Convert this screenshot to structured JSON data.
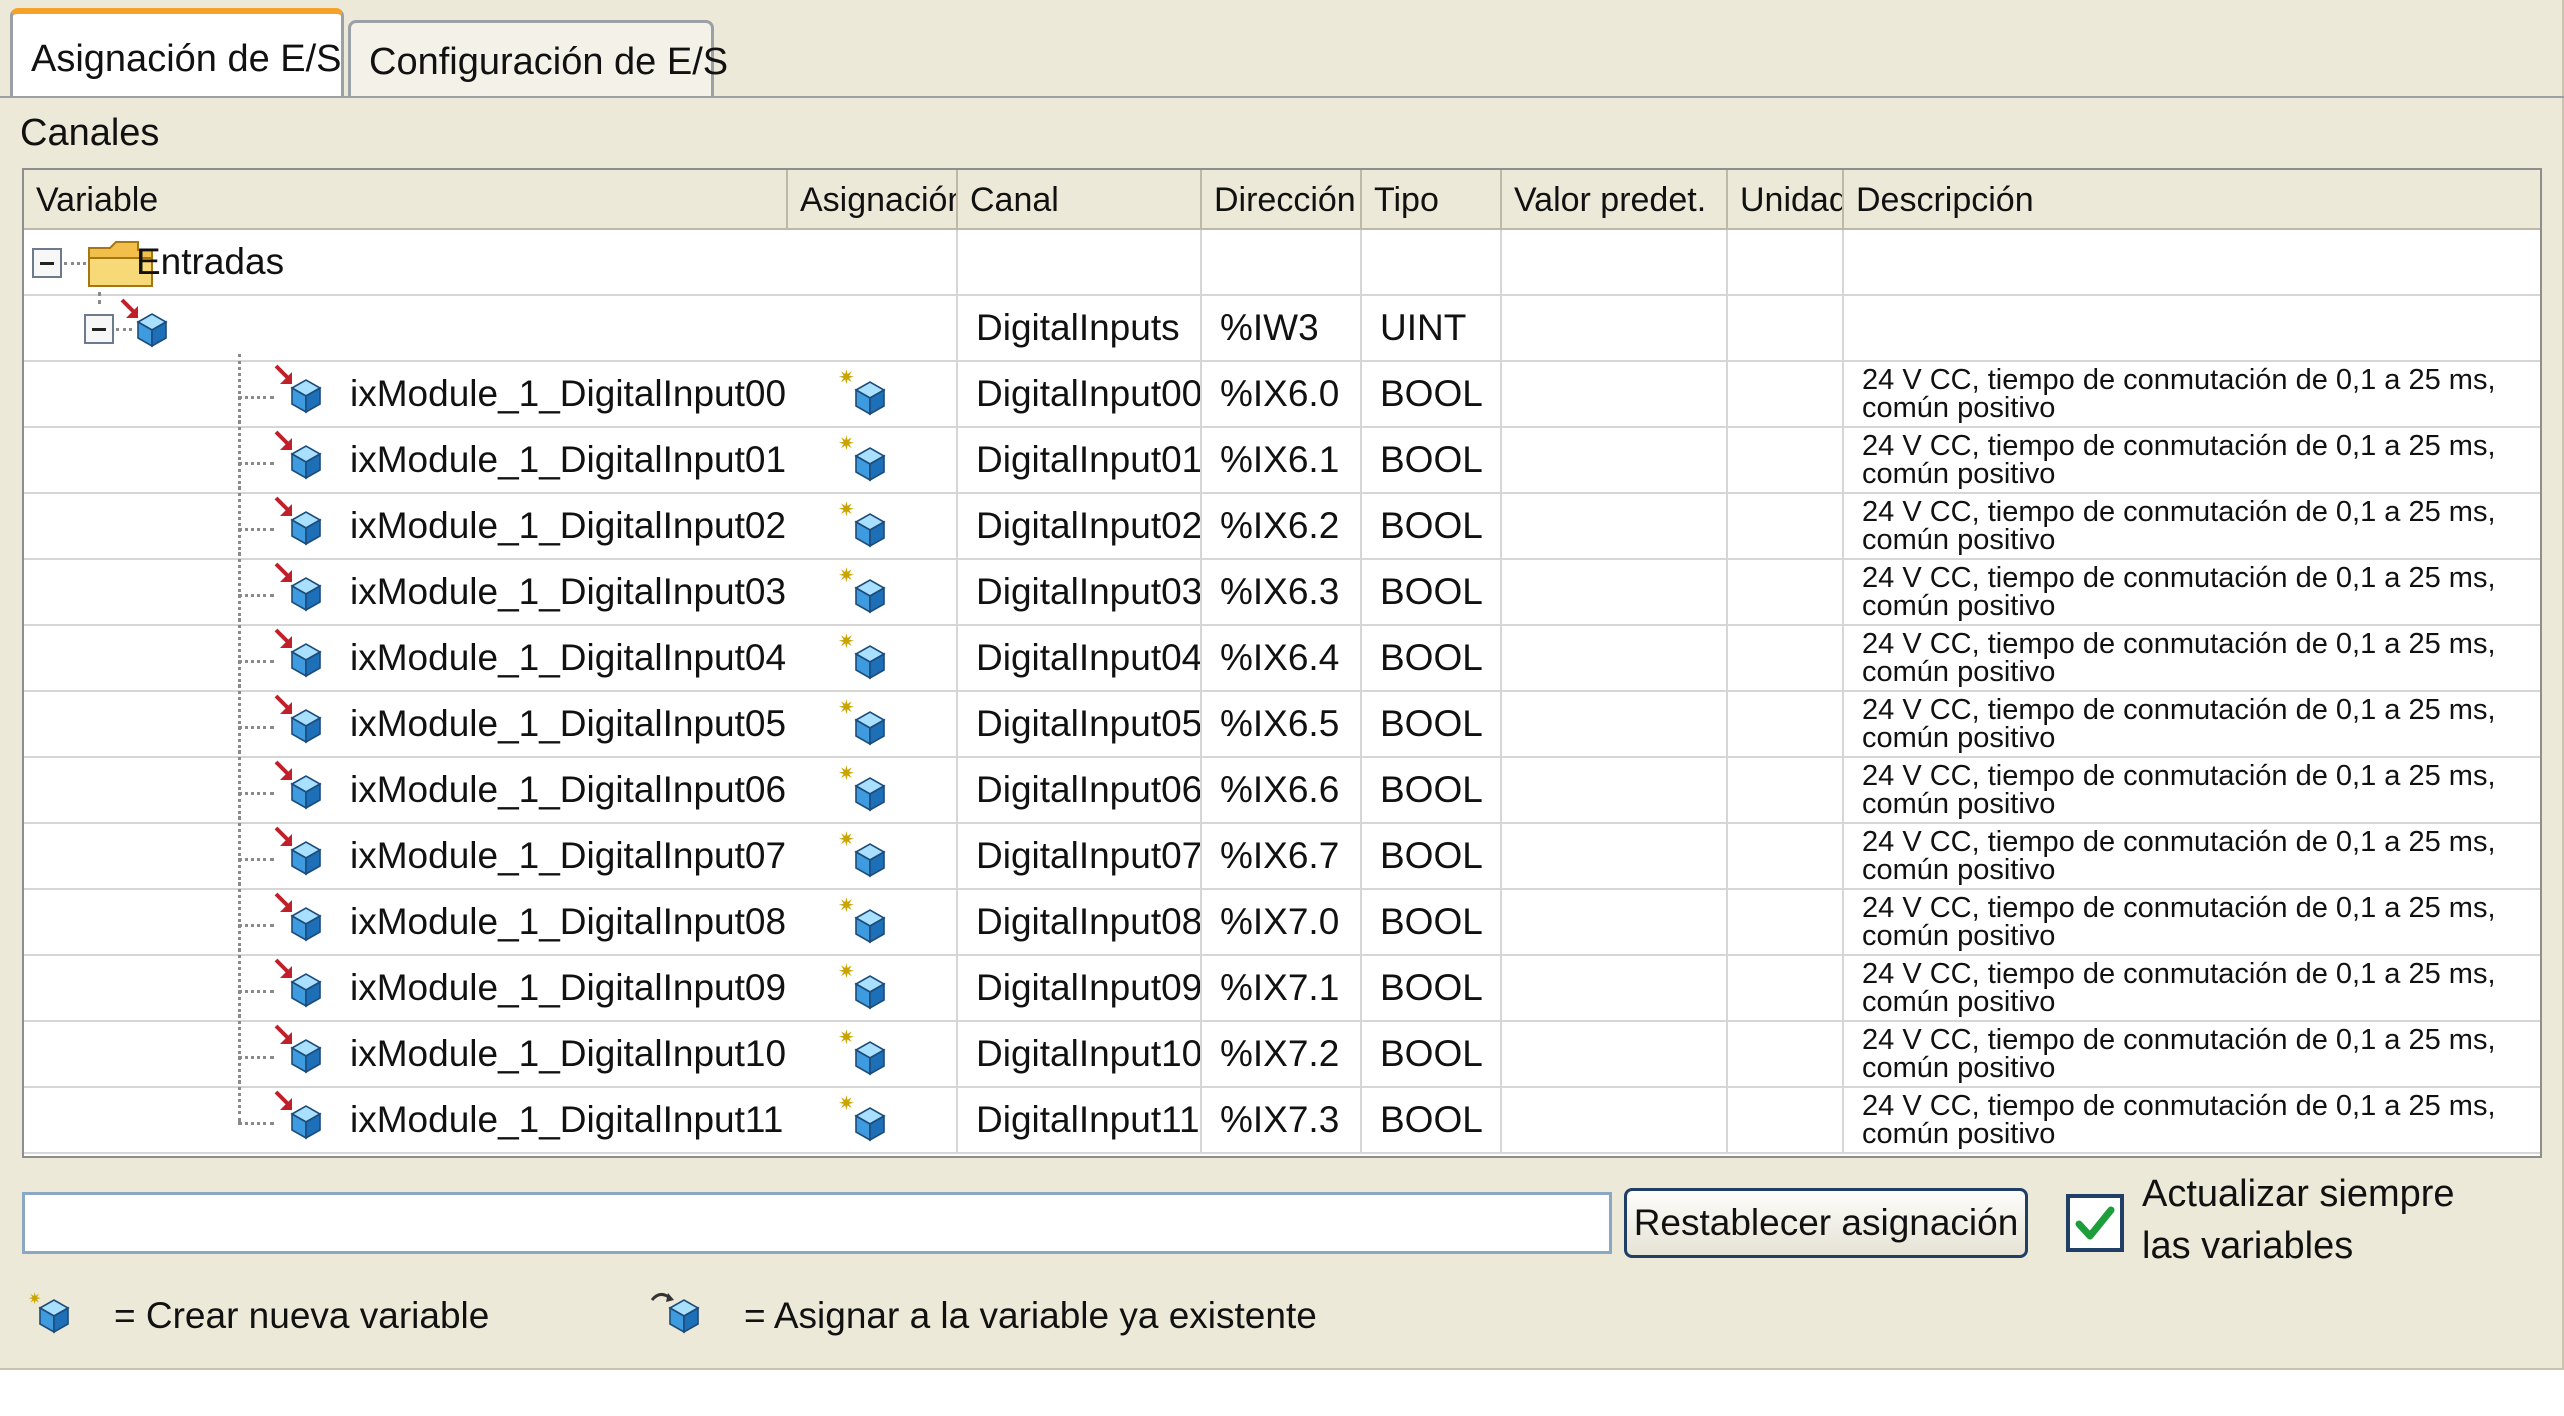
{
  "tabs": [
    {
      "label": "Asignación de E/S",
      "active": true
    },
    {
      "label": "Configuración de E/S",
      "active": false
    }
  ],
  "section_label": "Canales",
  "columns": [
    "Variable",
    "Asignación",
    "Canal",
    "Dirección",
    "Tipo",
    "Valor predet.",
    "Unidad",
    "Descripción"
  ],
  "tree": {
    "root_label": "Entradas",
    "group": {
      "channel": "DigitalInputs",
      "address": "%IW3",
      "type": "UINT"
    }
  },
  "rows": [
    {
      "variable": "ixModule_1_DigitalInput00",
      "channel": "DigitalInput00",
      "address": "%IX6.0",
      "type": "BOOL",
      "desc1": "24 V CC, tiempo de conmutación de 0,1 a 25 ms,",
      "desc2": "común positivo"
    },
    {
      "variable": "ixModule_1_DigitalInput01",
      "channel": "DigitalInput01",
      "address": "%IX6.1",
      "type": "BOOL",
      "desc1": "24 V CC, tiempo de conmutación de 0,1 a 25 ms,",
      "desc2": "común positivo"
    },
    {
      "variable": "ixModule_1_DigitalInput02",
      "channel": "DigitalInput02",
      "address": "%IX6.2",
      "type": "BOOL",
      "desc1": "24 V CC, tiempo de conmutación de 0,1 a 25 ms,",
      "desc2": "común positivo"
    },
    {
      "variable": "ixModule_1_DigitalInput03",
      "channel": "DigitalInput03",
      "address": "%IX6.3",
      "type": "BOOL",
      "desc1": "24 V CC, tiempo de conmutación de 0,1 a 25 ms,",
      "desc2": "común positivo"
    },
    {
      "variable": "ixModule_1_DigitalInput04",
      "channel": "DigitalInput04",
      "address": "%IX6.4",
      "type": "BOOL",
      "desc1": "24 V CC, tiempo de conmutación de 0,1 a 25 ms,",
      "desc2": "común positivo"
    },
    {
      "variable": "ixModule_1_DigitalInput05",
      "channel": "DigitalInput05",
      "address": "%IX6.5",
      "type": "BOOL",
      "desc1": "24 V CC, tiempo de conmutación de 0,1 a 25 ms,",
      "desc2": "común positivo"
    },
    {
      "variable": "ixModule_1_DigitalInput06",
      "channel": "DigitalInput06",
      "address": "%IX6.6",
      "type": "BOOL",
      "desc1": "24 V CC, tiempo de conmutación de 0,1 a 25 ms,",
      "desc2": "común positivo"
    },
    {
      "variable": "ixModule_1_DigitalInput07",
      "channel": "DigitalInput07",
      "address": "%IX6.7",
      "type": "BOOL",
      "desc1": "24 V CC, tiempo de conmutación de 0,1 a 25 ms,",
      "desc2": "común positivo"
    },
    {
      "variable": "ixModule_1_DigitalInput08",
      "channel": "DigitalInput08",
      "address": "%IX7.0",
      "type": "BOOL",
      "desc1": "24 V CC, tiempo de conmutación de 0,1 a 25 ms,",
      "desc2": "común positivo"
    },
    {
      "variable": "ixModule_1_DigitalInput09",
      "channel": "DigitalInput09",
      "address": "%IX7.1",
      "type": "BOOL",
      "desc1": "24 V CC, tiempo de conmutación de 0,1 a 25 ms,",
      "desc2": "común positivo"
    },
    {
      "variable": "ixModule_1_DigitalInput10",
      "channel": "DigitalInput10",
      "address": "%IX7.2",
      "type": "BOOL",
      "desc1": "24 V CC, tiempo de conmutación de 0,1 a 25 ms,",
      "desc2": "común positivo"
    },
    {
      "variable": "ixModule_1_DigitalInput11",
      "channel": "DigitalInput11",
      "address": "%IX7.3",
      "type": "BOOL",
      "desc1": "24 V CC, tiempo de conmutación de 0,1 a 25 ms,",
      "desc2": "común positivo"
    }
  ],
  "filter_value": "",
  "reset_button_label": "Restablecer asignación",
  "always_update": {
    "line1": "Actualizar siempre",
    "line2": "las variables",
    "checked": true
  },
  "legend": {
    "create_new": "= Crear nueva variable",
    "assign_existing": "= Asignar a la variable ya existente"
  },
  "icons": {
    "folder": "folder-icon",
    "variable": "variable-cube-icon",
    "new_variable": "new-variable-icon",
    "existing_variable": "existing-variable-icon",
    "collapse": "collapse-icon",
    "check": "checkmark-icon"
  },
  "colors": {
    "panel_bg": "#ece9d8",
    "active_tab_accent": "#f4a328",
    "cube_top": "#8fd3ff",
    "cube_side": "#2f8fd8",
    "arrow_red": "#c0202a",
    "check_green": "#1e9e3a"
  }
}
